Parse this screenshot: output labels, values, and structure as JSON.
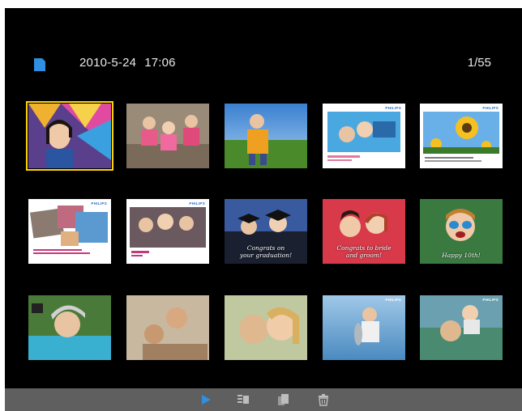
{
  "status_bar": {
    "storage_icon": "sd-card-icon",
    "date": "2010-5-24",
    "time": "17:06",
    "photo_counter": "1/55"
  },
  "thumbnails": [
    {
      "name": "girl-umbrella",
      "caption": "",
      "selected": true
    },
    {
      "name": "three-kids",
      "caption": ""
    },
    {
      "name": "boy-field",
      "caption": ""
    },
    {
      "name": "card-friends",
      "caption": "",
      "brand": "PHILIPS"
    },
    {
      "name": "card-sunflowers",
      "caption": "",
      "brand": "PHILIPS"
    },
    {
      "name": "card-family-collage",
      "caption": "",
      "brand": "PHILIPS"
    },
    {
      "name": "card-perfect",
      "caption": "",
      "brand": "PHILIPS"
    },
    {
      "name": "graduation",
      "caption": "Congrats on\nyour graduation!"
    },
    {
      "name": "couple",
      "caption": "Congrats to bride\nand groom!"
    },
    {
      "name": "goggles-kid",
      "caption": "Happy 10th!"
    },
    {
      "name": "kid-helmet",
      "caption": ""
    },
    {
      "name": "father-kids",
      "caption": ""
    },
    {
      "name": "mother-child",
      "caption": ""
    },
    {
      "name": "boy-fish",
      "caption": ""
    },
    {
      "name": "mother-baby",
      "caption": ""
    }
  ],
  "toolbar": {
    "buttons": [
      {
        "icon": "play-slideshow-icon",
        "color": "#2f8fe0"
      },
      {
        "icon": "settings-menu-icon",
        "color": "#bdbdbd"
      },
      {
        "icon": "copy-photo-icon",
        "color": "#bdbdbd"
      },
      {
        "icon": "delete-trash-icon",
        "color": "#bdbdbd"
      }
    ]
  },
  "colors": {
    "background": "#000000",
    "selection": "#ffd400",
    "toolbar": "#5f5f5f",
    "accent": "#2f8fe0"
  }
}
